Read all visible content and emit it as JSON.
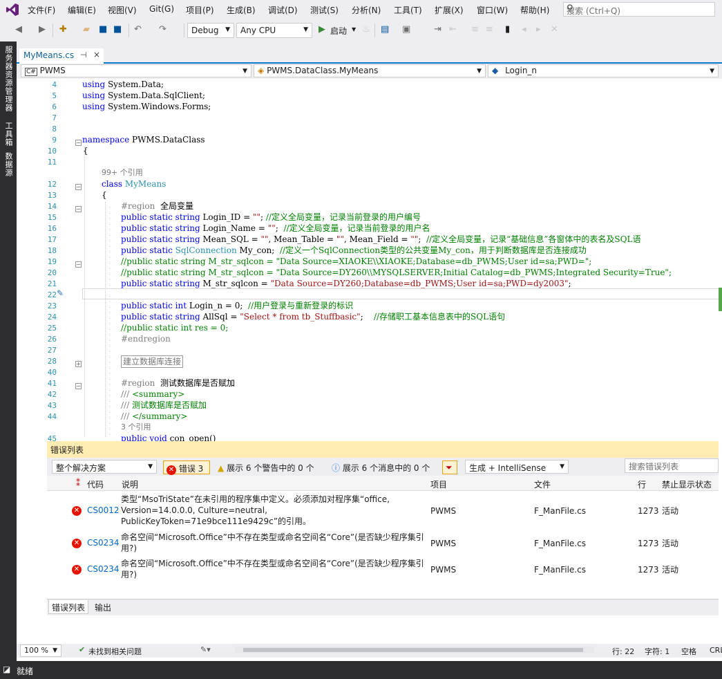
{
  "menu": [
    "文件(F)",
    "编辑(E)",
    "视图(V)",
    "Git(G)",
    "项目(P)",
    "生成(B)",
    "调试(D)",
    "测试(S)",
    "分析(N)",
    "工具(T)",
    "扩展(X)",
    "窗口(W)",
    "帮助(H)"
  ],
  "search": {
    "placeholder": "搜索 (Ctrl+Q)"
  },
  "toolbar": {
    "config": "Debug",
    "platform": "Any CPU",
    "start": "启动"
  },
  "side_tabs": [
    "服务器资源管理器",
    "工具箱",
    "数据源"
  ],
  "doc_tab": {
    "name": "MyMeans.cs",
    "pin": "⊣",
    "close": "×"
  },
  "navbar": {
    "project": "PWMS",
    "class": "PWMS.DataClass.MyMeans",
    "member": "Login_n"
  },
  "code_lines": [
    {
      "n": "4",
      "t": "using System.Data;"
    },
    {
      "n": "5",
      "t": "using System.Data.SqlClient;"
    },
    {
      "n": "6",
      "t": "using System.Windows.Forms;"
    },
    {
      "n": "7",
      "t": ""
    },
    {
      "n": "8",
      "t": ""
    },
    {
      "n": "9",
      "t": "namespace PWMS.DataClass"
    },
    {
      "n": "10",
      "t": "{"
    },
    {
      "n": "11",
      "t": ""
    },
    {
      "n": "",
      "t": "99+ 个引用"
    },
    {
      "n": "12",
      "t": "class MyMeans"
    },
    {
      "n": "13",
      "t": "{"
    },
    {
      "n": "14",
      "t": "#region  全局变量"
    },
    {
      "n": "15",
      "t": "public static string Login_ID = \"\"; //定义全局变量，记录当前登录的用户编号"
    },
    {
      "n": "16",
      "t": "public static string Login_Name = \"\";  //定义全局变量，记录当前登录的用户名"
    },
    {
      "n": "17",
      "t": "public static string Mean_SQL = \"\", Mean_Table = \"\", Mean_Field = \"\";  //定义全局变量，记录“基础信息”各窗体中的表名及SQL语"
    },
    {
      "n": "18",
      "t": "public static SqlConnection My_con;  //定义一个SqlConnection类型的公共变量My_con，用于判断数据库是否连接成功"
    },
    {
      "n": "19",
      "t": "//public static string M_str_sqlcon = \"Data Source=XIAOKE\\\\XIAOKE;Database=db_PWMS;User id=sa;PWD=\";"
    },
    {
      "n": "20",
      "t": "//public static string M_str_sqlcon = \"Data Source=DY260\\\\MYSQLSERVER;Initial Catalog=db_PWMS;Integrated Security=True\";"
    },
    {
      "n": "21",
      "t": "public static string M_str_sqlcon = \"Data Source=DY260;Database=db_PWMS;User id=sa;PWD=dy2003\";"
    },
    {
      "n": "22",
      "t": ""
    },
    {
      "n": "23",
      "t": "public static int Login_n = 0;  //用户登录与重新登录的标识"
    },
    {
      "n": "24",
      "t": "public static string AllSql = \"Select * from tb_Stuffbasic\";    //存储职工基本信息表中的SQL语句"
    },
    {
      "n": "25",
      "t": "//public static int res = 0;"
    },
    {
      "n": "26",
      "t": "#endregion"
    },
    {
      "n": "27",
      "t": ""
    },
    {
      "n": "28",
      "t": "建立数据库连接"
    },
    {
      "n": "40",
      "t": ""
    },
    {
      "n": "41",
      "t": "#region  测试数据库是否赋加"
    },
    {
      "n": "42",
      "t": "/// <summary>"
    },
    {
      "n": "43",
      "t": "/// 测试数据库是否赋加"
    },
    {
      "n": "44",
      "t": "/// </summary>"
    },
    {
      "n": "",
      "t": "3 个引用"
    },
    {
      "n": "45",
      "t": "public void con_open()"
    }
  ],
  "error_list": {
    "title": "错误列表",
    "scope": "整个解决方案",
    "errors_btn": "错误 3",
    "warnings_btn": "展示 6 个警告中的 0 个",
    "messages_btn": "展示 6 个消息中的 0 个",
    "build_filter": "生成 + IntelliSense",
    "search_placeholder": "搜索错误列表",
    "headers": {
      "code": "代码",
      "desc": "说明",
      "project": "项目",
      "file": "文件",
      "line": "行",
      "suppress": "禁止显示状态"
    },
    "rows": [
      {
        "code": "CS0012",
        "desc": "类型“MsoTriState”在未引用的程序集中定义。必须添加对程序集“office, Version=14.0.0.0, Culture=neutral, PublicKeyToken=71e9bce111e9429c”的引用。",
        "project": "PWMS",
        "file": "F_ManFile.cs",
        "line": "1273",
        "state": "活动"
      },
      {
        "code": "CS0234",
        "desc": "命名空间“Microsoft.Office”中不存在类型或命名空间名“Core”(是否缺少程序集引用?)",
        "project": "PWMS",
        "file": "F_ManFile.cs",
        "line": "1273",
        "state": "活动"
      },
      {
        "code": "CS0234",
        "desc": "命名空间“Microsoft.Office”中不存在类型或命名空间名“Core”(是否缺少程序集引用?)",
        "project": "PWMS",
        "file": "F_ManFile.cs",
        "line": "1273",
        "state": "活动"
      }
    ],
    "tabs": [
      "错误列表",
      "输出"
    ]
  },
  "editor_status": {
    "zoom": "100 %",
    "issues": "未找到相关问题",
    "line": "行: 22",
    "col": "字符: 1",
    "spaces": "空格",
    "crlf": "CRL"
  },
  "app_status": "就绪"
}
